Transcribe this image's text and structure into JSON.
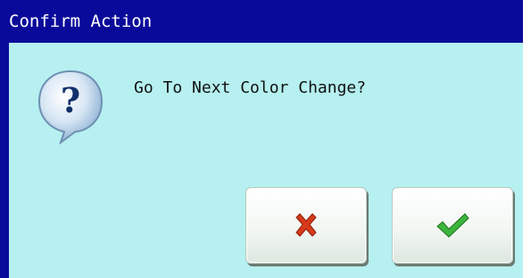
{
  "window": {
    "title": "Confirm Action"
  },
  "dialog": {
    "message": "Go To Next Color Change?",
    "icon": "question-bubble-icon",
    "colors": {
      "titlebar": "#0a0a9a",
      "body": "#b6f0f0",
      "title_text": "#ffffff"
    }
  },
  "buttons": {
    "cancel": {
      "icon": "red-x-icon",
      "color": "#d63a1a"
    },
    "ok": {
      "icon": "green-check-icon",
      "color": "#3bb53b"
    }
  }
}
